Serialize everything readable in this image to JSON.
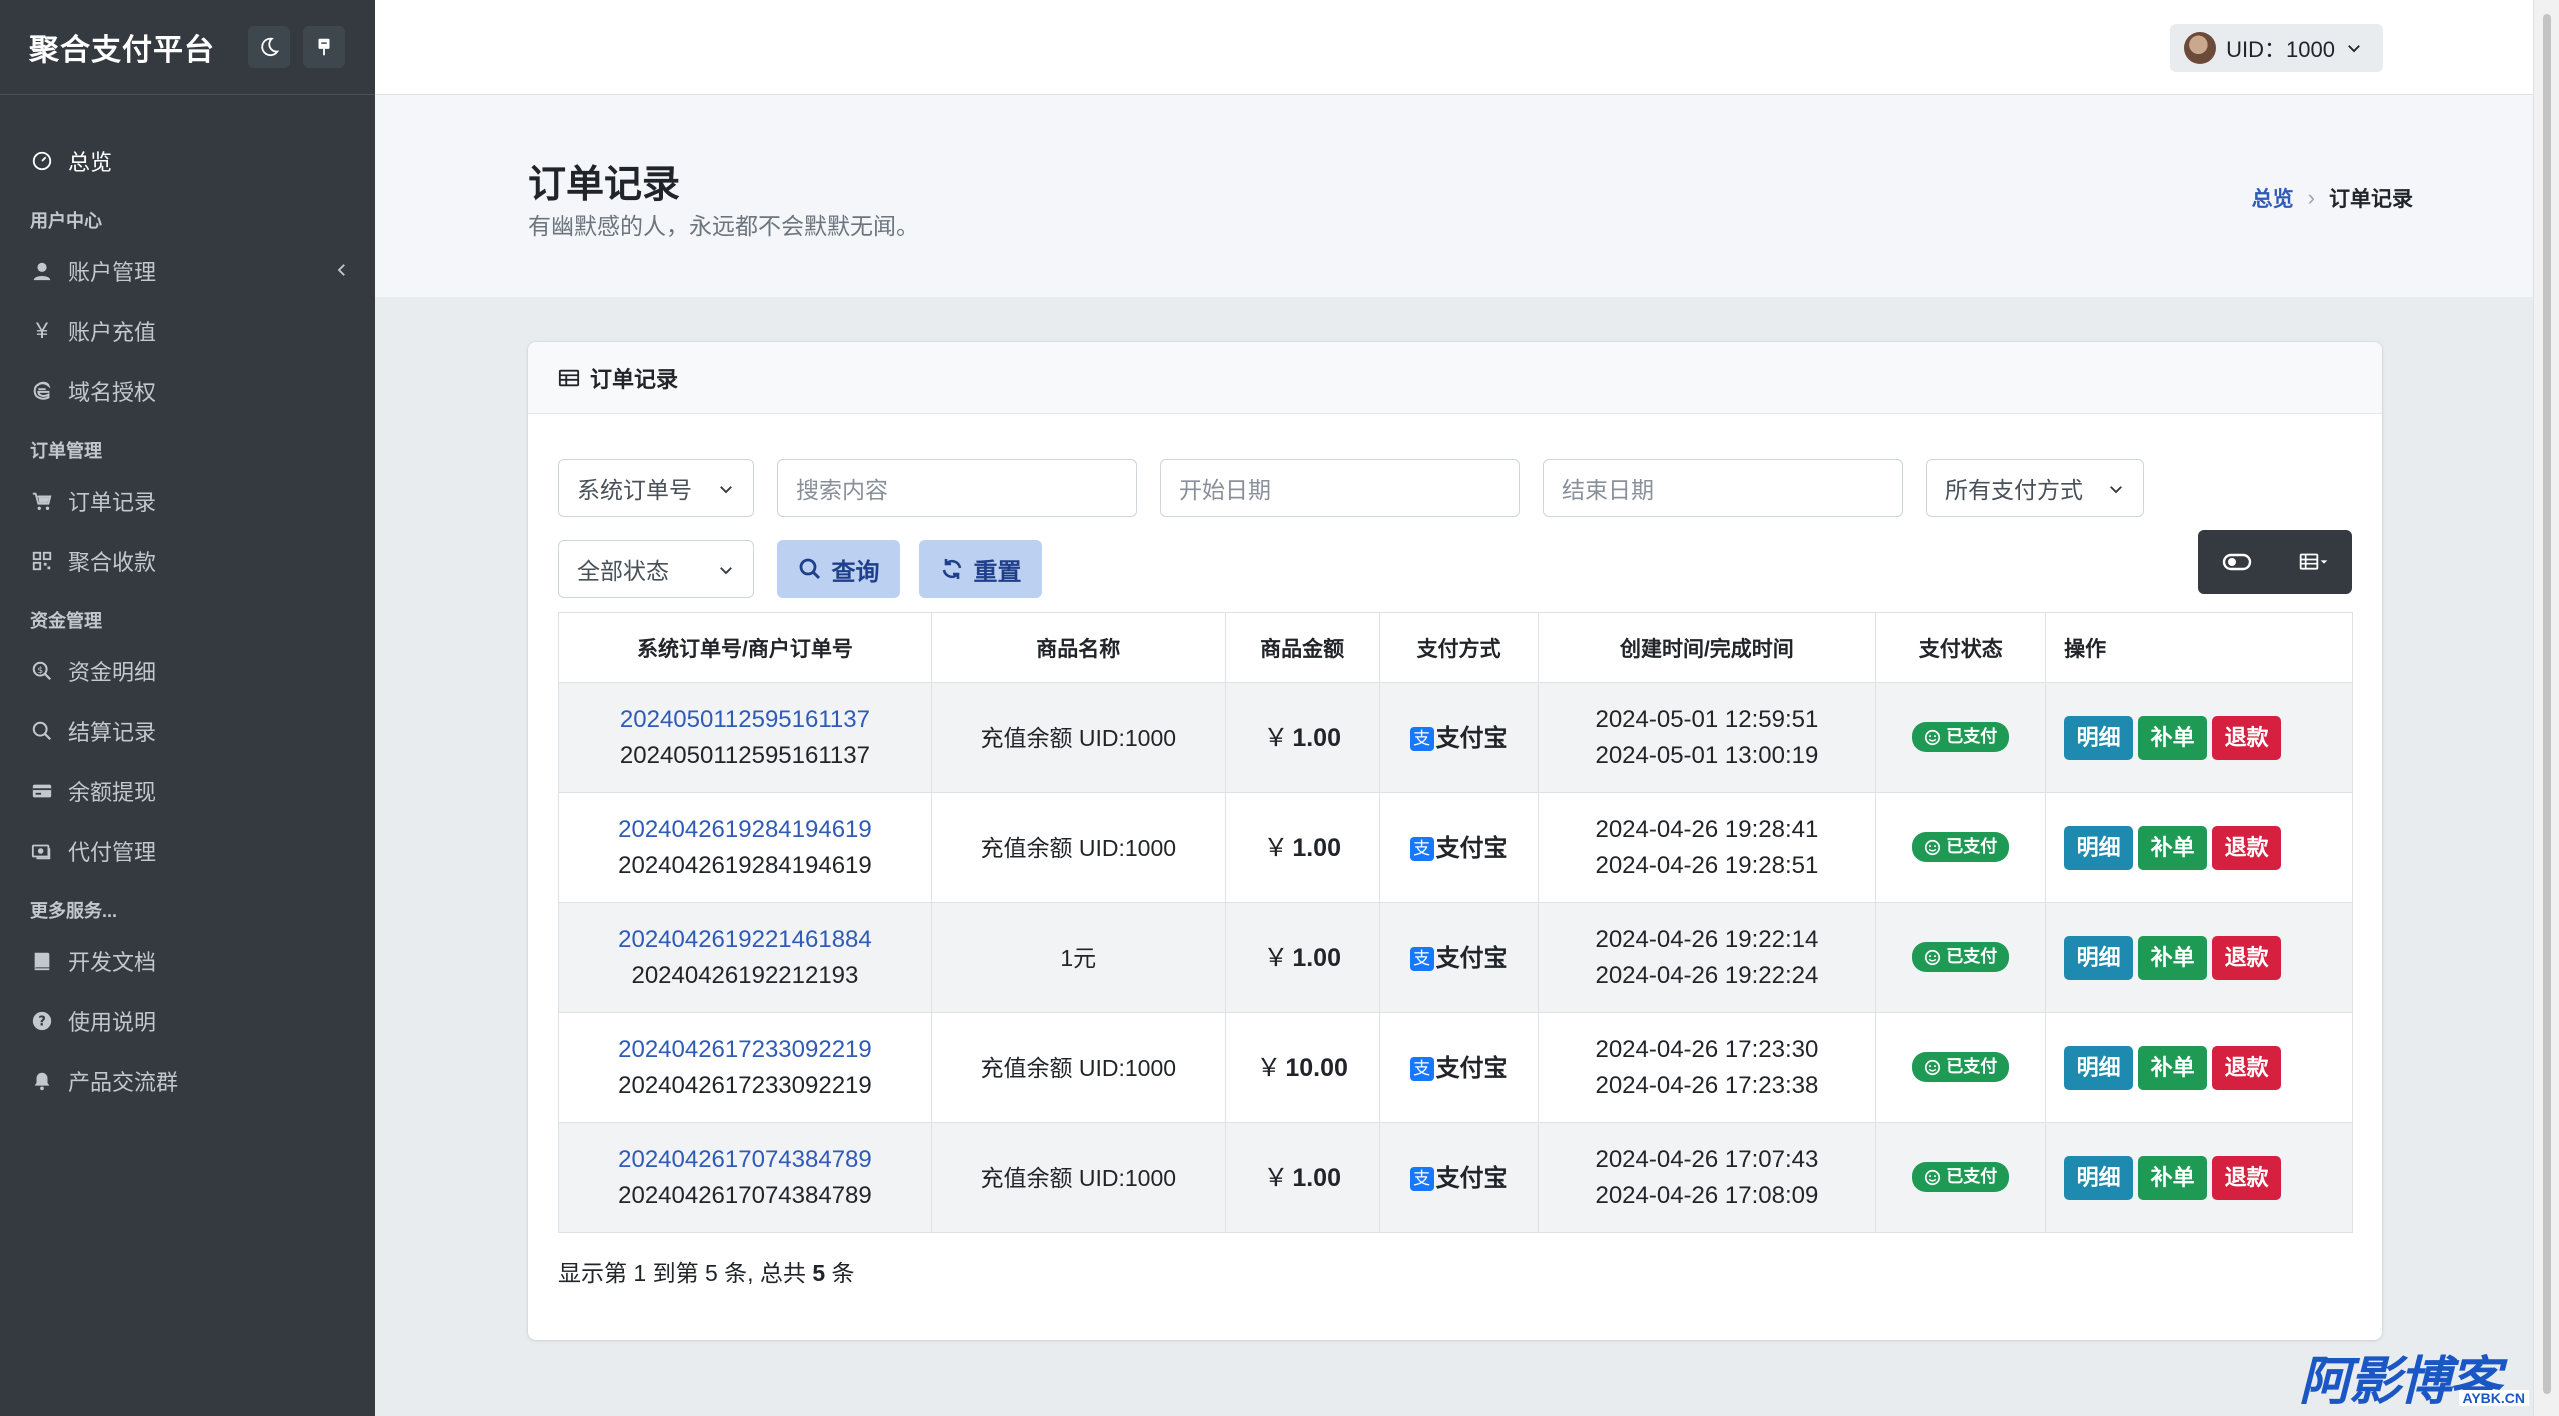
{
  "sidebar": {
    "brand": "聚合支付平台",
    "items": {
      "overview": "总览",
      "account_manage": "账户管理",
      "account_recharge": "账户充值",
      "domain_auth": "域名授权",
      "order_records": "订单记录",
      "aggregate_receive": "聚合收款",
      "fund_detail": "资金明细",
      "settle_records": "结算记录",
      "balance_withdraw": "余额提现",
      "proxy_pay": "代付管理",
      "dev_docs": "开发文档",
      "usage_guide": "使用说明",
      "community": "产品交流群"
    },
    "headers": {
      "user_center": "用户中心",
      "order_manage": "订单管理",
      "fund_manage": "资金管理",
      "more_services": "更多服务..."
    }
  },
  "topbar": {
    "user_label": "UID：1000"
  },
  "header": {
    "title": "订单记录",
    "subtitle": "有幽默感的人，永远都不会默默无闻。",
    "breadcrumb": {
      "home": "总览",
      "current": "订单记录"
    }
  },
  "card": {
    "title": "订单记录"
  },
  "filters": {
    "search_type": "系统订单号",
    "search_placeholder": "搜索内容",
    "start_date_placeholder": "开始日期",
    "end_date_placeholder": "结束日期",
    "pay_type": "所有支付方式",
    "status": "全部状态",
    "query_label": "查询",
    "reset_label": "重置"
  },
  "table": {
    "headers": [
      "系统订单号/商户订单号",
      "商品名称",
      "商品金额",
      "支付方式",
      "创建时间/完成时间",
      "支付状态",
      "操作"
    ],
    "currency": "￥",
    "rows": [
      {
        "trade_no": "2024050112595161137",
        "out_trade_no": "2024050112595161137",
        "name": "充值余额 UID:1000",
        "amount": "1.00",
        "pay": "支付宝",
        "created": "2024-05-01 12:59:51",
        "finished": "2024-05-01 13:00:19",
        "status": "已支付"
      },
      {
        "trade_no": "2024042619284194619",
        "out_trade_no": "2024042619284194619",
        "name": "充值余额 UID:1000",
        "amount": "1.00",
        "pay": "支付宝",
        "created": "2024-04-26 19:28:41",
        "finished": "2024-04-26 19:28:51",
        "status": "已支付"
      },
      {
        "trade_no": "2024042619221461884",
        "out_trade_no": "20240426192212193",
        "name": "1元",
        "amount": "1.00",
        "pay": "支付宝",
        "created": "2024-04-26 19:22:14",
        "finished": "2024-04-26 19:22:24",
        "status": "已支付"
      },
      {
        "trade_no": "2024042617233092219",
        "out_trade_no": "2024042617233092219",
        "name": "充值余额 UID:1000",
        "amount": "10.00",
        "pay": "支付宝",
        "created": "2024-04-26 17:23:30",
        "finished": "2024-04-26 17:23:38",
        "status": "已支付"
      },
      {
        "trade_no": "2024042617074384789",
        "out_trade_no": "2024042617074384789",
        "name": "充值余额 UID:1000",
        "amount": "1.00",
        "pay": "支付宝",
        "created": "2024-04-26 17:07:43",
        "finished": "2024-04-26 17:08:09",
        "status": "已支付"
      }
    ],
    "actions": {
      "detail": "明细",
      "repair": "补单",
      "refund": "退款"
    },
    "ali_glyph": "支"
  },
  "summary": {
    "prefix": "显示第 1 到第 5 条, 总共 ",
    "total": "5",
    "suffix": " 条"
  },
  "watermark": {
    "main": "阿影博客",
    "domain": "AYBK.CN"
  },
  "colors": {
    "sidebar": "#343a40",
    "primary_link": "#2f5bb7",
    "success": "#1f9a55",
    "info": "#1e8aaf",
    "danger": "#d6203f"
  }
}
